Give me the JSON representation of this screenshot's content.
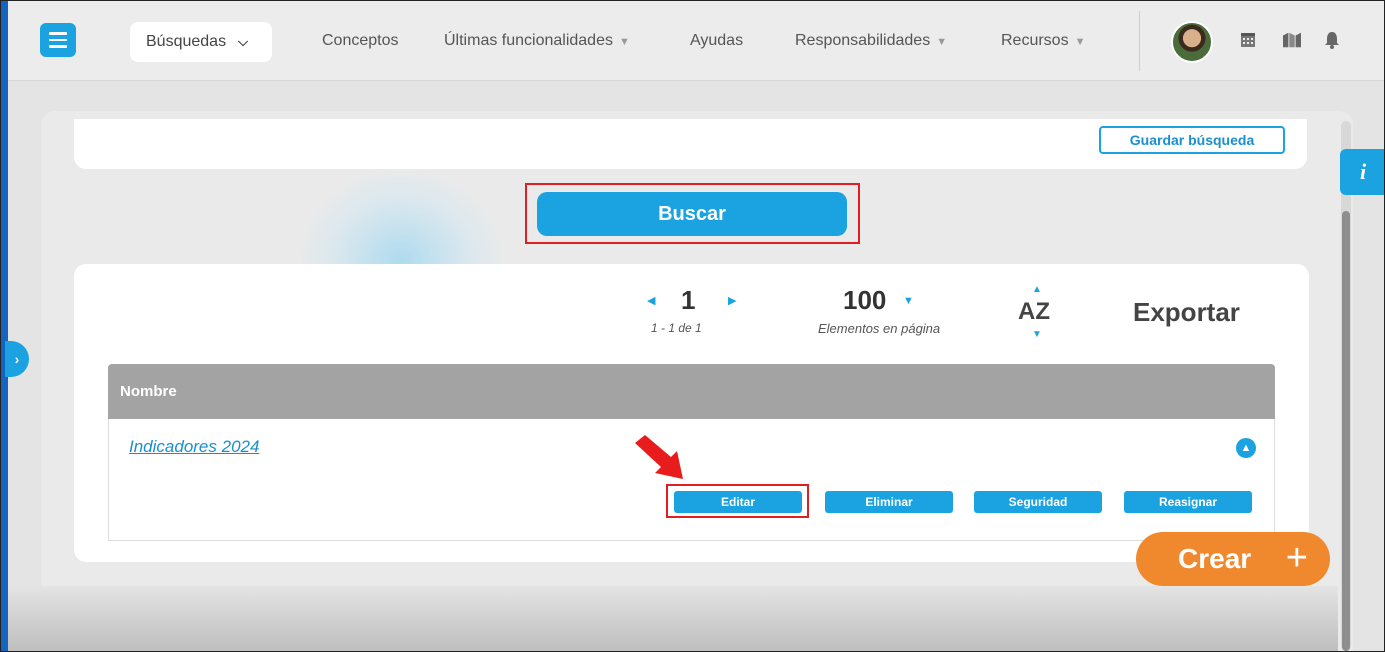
{
  "topbar": {
    "menu_icon": "hamburger-icon",
    "search_dropdown_label": "Búsquedas",
    "nav": [
      {
        "label": "Conceptos",
        "has_caret": false
      },
      {
        "label": "Últimas funcionalidades",
        "has_caret": true
      },
      {
        "label": "Ayudas",
        "has_caret": false
      },
      {
        "label": "Responsabilidades",
        "has_caret": true
      },
      {
        "label": "Recursos",
        "has_caret": true
      }
    ],
    "icons": [
      "avatar",
      "calendar-icon",
      "map-icon",
      "bell-icon"
    ]
  },
  "search": {
    "save_label": "Guardar búsqueda",
    "search_button_label": "Buscar"
  },
  "pager": {
    "current_page": "1",
    "range_text": "1 - 1 de 1",
    "per_page": "100",
    "per_page_label": "Elementos en página",
    "sort_label": "AZ",
    "export_label": "Exportar"
  },
  "table": {
    "header": "Nombre",
    "rows": [
      {
        "name": "Indicadores 2024",
        "actions": [
          "Editar",
          "Eliminar",
          "Seguridad",
          "Reasignar"
        ]
      }
    ]
  },
  "fab": {
    "create_label": "Crear",
    "plus": "+"
  },
  "info_tab_label": "i",
  "colors": {
    "accent": "#1aa3e0",
    "create": "#f0892e",
    "highlight": "#e02020"
  }
}
